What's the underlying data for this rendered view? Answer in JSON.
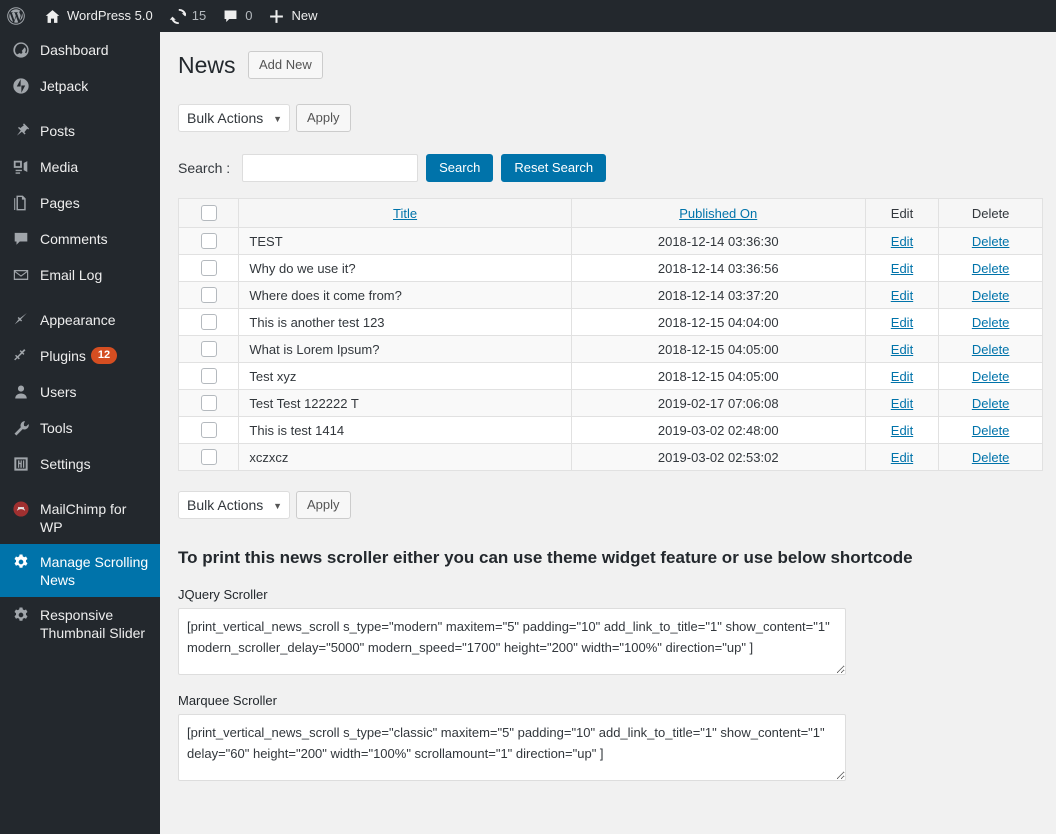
{
  "adminbar": {
    "wp_logo": "wordpress-logo-icon",
    "site_name": "WordPress 5.0",
    "home_icon": "home-icon",
    "updates_icon": "updates-icon",
    "updates_count": "15",
    "comments_icon": "comment-bubble-icon",
    "comments_count": "0",
    "new_icon": "plus-icon",
    "new_label": "New"
  },
  "sidebar": {
    "items": [
      {
        "label": "Dashboard",
        "icon": "dashboard-icon",
        "key": "dashboard",
        "separator": false,
        "current": false
      },
      {
        "label": "Jetpack",
        "icon": "jetpack-icon",
        "key": "jetpack",
        "separator": false,
        "current": false
      },
      {
        "label": "Posts",
        "icon": "pin-icon",
        "key": "posts",
        "separator": true,
        "current": false
      },
      {
        "label": "Media",
        "icon": "media-icon",
        "key": "media",
        "separator": false,
        "current": false
      },
      {
        "label": "Pages",
        "icon": "pages-icon",
        "key": "pages",
        "separator": false,
        "current": false
      },
      {
        "label": "Comments",
        "icon": "comment-bubble-icon",
        "key": "comments",
        "separator": false,
        "current": false
      },
      {
        "label": "Email Log",
        "icon": "envelope-icon",
        "key": "email-log",
        "separator": false,
        "current": false
      },
      {
        "label": "Appearance",
        "icon": "paintbrush-icon",
        "key": "appearance",
        "separator": true,
        "current": false
      },
      {
        "label": "Plugins",
        "icon": "plug-icon",
        "key": "plugins",
        "separator": false,
        "current": false,
        "badge": "12"
      },
      {
        "label": "Users",
        "icon": "user-icon",
        "key": "users",
        "separator": false,
        "current": false
      },
      {
        "label": "Tools",
        "icon": "wrench-icon",
        "key": "tools",
        "separator": false,
        "current": false
      },
      {
        "label": "Settings",
        "icon": "settings-sliders-icon",
        "key": "settings",
        "separator": false,
        "current": false
      },
      {
        "label": "MailChimp for WP",
        "icon": "mailchimp-icon",
        "key": "mailchimp-for-wp",
        "separator": true,
        "current": false
      },
      {
        "label": "Manage Scrolling News",
        "icon": "gear-icon",
        "key": "manage-scrolling-news",
        "separator": false,
        "current": true
      },
      {
        "label": "Responsive Thumbnail Slider",
        "icon": "gear-icon",
        "key": "responsive-thumbnail-slider",
        "separator": false,
        "current": false
      }
    ]
  },
  "page": {
    "title": "News",
    "add_new_label": "Add New"
  },
  "tablenav_top": {
    "bulk_actions_label": "Bulk Actions",
    "apply_label": "Apply"
  },
  "tablenav_bottom": {
    "bulk_actions_label": "Bulk Actions",
    "apply_label": "Apply"
  },
  "search": {
    "label": "Search :",
    "value": "",
    "placeholder": "",
    "search_button": "Search",
    "reset_button": "Reset Search"
  },
  "table": {
    "columns": {
      "cb": "",
      "title": "Title",
      "date": "Published On",
      "edit": "Edit",
      "delete": "Delete"
    },
    "row_edit_label": "Edit",
    "row_delete_label": "Delete",
    "rows": [
      {
        "title": "TEST",
        "date": "2018-12-14 03:36:30"
      },
      {
        "title": "Why do we use it?",
        "date": "2018-12-14 03:36:56"
      },
      {
        "title": "Where does it come from?",
        "date": "2018-12-14 03:37:20"
      },
      {
        "title": "This is another test 123",
        "date": "2018-12-15 04:04:00"
      },
      {
        "title": "What is Lorem Ipsum?",
        "date": "2018-12-15 04:05:00"
      },
      {
        "title": "Test xyz",
        "date": "2018-12-15 04:05:00"
      },
      {
        "title": "Test Test 122222 T",
        "date": "2019-02-17 07:06:08"
      },
      {
        "title": "This is test 1414",
        "date": "2019-03-02 02:48:00"
      },
      {
        "title": "xczxcz",
        "date": "2019-03-02 02:53:02"
      }
    ]
  },
  "shortcodes": {
    "heading": "To print this news scroller either you can use theme widget feature or use below shortcode",
    "jquery_label": "JQuery Scroller",
    "jquery_value": "[print_vertical_news_scroll s_type=\"modern\" maxitem=\"5\" padding=\"10\" add_link_to_title=\"1\" show_content=\"1\" modern_scroller_delay=\"5000\" modern_speed=\"1700\" height=\"200\" width=\"100%\" direction=\"up\" ]",
    "marquee_label": "Marquee Scroller",
    "marquee_value": "[print_vertical_news_scroll s_type=\"classic\" maxitem=\"5\" padding=\"10\" add_link_to_title=\"1\" show_content=\"1\" delay=\"60\" height=\"200\" width=\"100%\" scrollamount=\"1\" direction=\"up\" ]"
  },
  "colors": {
    "admin_dark": "#23282d",
    "accent_blue": "#0073aa",
    "badge_orange": "#d54e21",
    "content_bg": "#f1f1f1"
  }
}
